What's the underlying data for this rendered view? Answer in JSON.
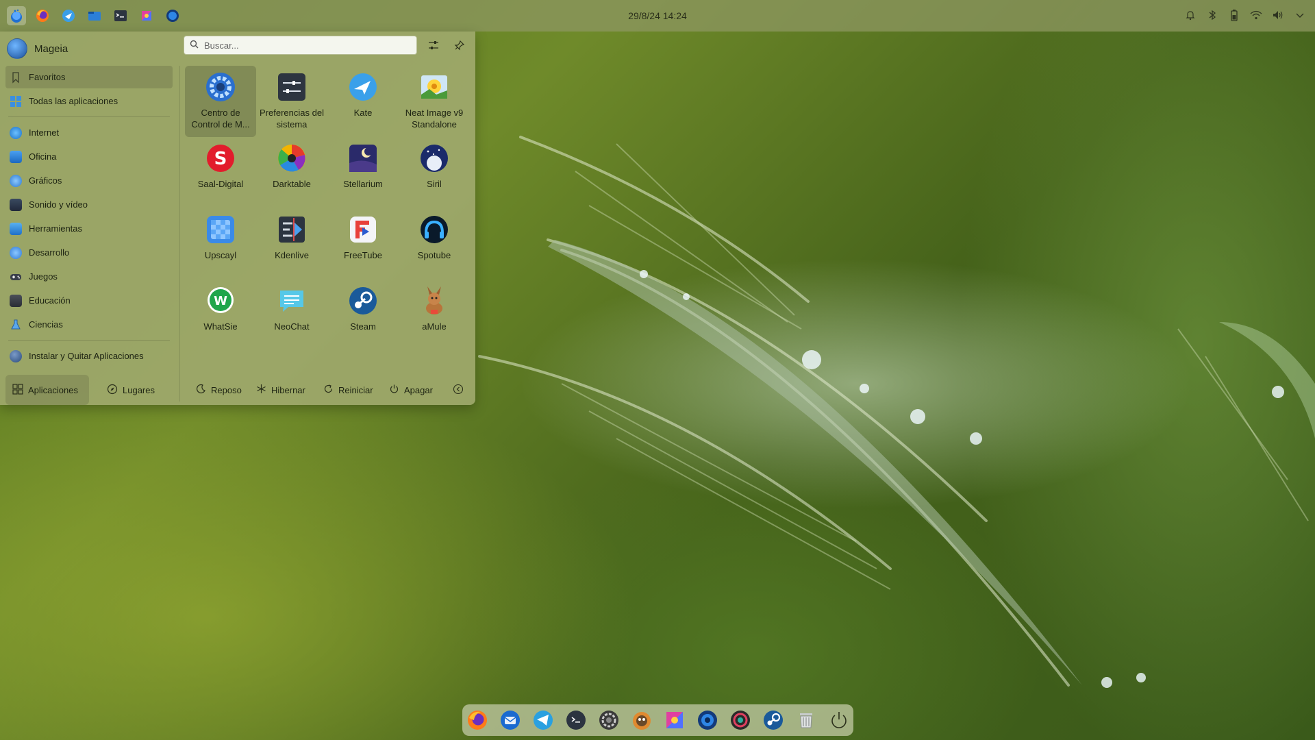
{
  "top_panel": {
    "clock": "29/8/24 14:24",
    "launchers": [
      "mageia-launcher-icon",
      "firefox-icon",
      "kate-icon",
      "dolphin-icon",
      "konsole-icon",
      "kdenlive-icon",
      "world-icon"
    ],
    "tray": [
      "bell-icon",
      "bluetooth-icon",
      "battery-icon",
      "wifi-icon",
      "volume-icon",
      "chevron-down-icon"
    ]
  },
  "launcher": {
    "user_name": "Mageia",
    "search_placeholder": "Buscar...",
    "categories": [
      {
        "label": "Favoritos",
        "icon": "bookmark-icon",
        "selected": true
      },
      {
        "label": "Todas las aplicaciones",
        "icon": "grid-icon"
      },
      {
        "label": "Internet",
        "icon": "globe-icon"
      },
      {
        "label": "Oficina",
        "icon": "office-icon"
      },
      {
        "label": "Gráficos",
        "icon": "graphics-icon"
      },
      {
        "label": "Sonido y vídeo",
        "icon": "multimedia-icon"
      },
      {
        "label": "Herramientas",
        "icon": "tools-icon"
      },
      {
        "label": "Desarrollo",
        "icon": "development-icon"
      },
      {
        "label": "Juegos",
        "icon": "gamepad-icon"
      },
      {
        "label": "Educación",
        "icon": "education-icon"
      },
      {
        "label": "Ciencias",
        "icon": "science-icon"
      },
      {
        "label": "Instalar y Quitar Aplicaciones",
        "icon": "install-icon"
      }
    ],
    "apps": [
      {
        "label": "Centro de Control de M...",
        "icon": "control-center-icon",
        "selected": true
      },
      {
        "label": "Preferencias del sistema",
        "icon": "system-settings-icon"
      },
      {
        "label": "Kate",
        "icon": "kate-icon"
      },
      {
        "label": "Neat Image v9 Standalone",
        "icon": "neat-image-icon"
      },
      {
        "label": "Saal-Digital",
        "icon": "saal-digital-icon"
      },
      {
        "label": "Darktable",
        "icon": "darktable-icon"
      },
      {
        "label": "Stellarium",
        "icon": "stellarium-icon"
      },
      {
        "label": "Siril",
        "icon": "siril-icon"
      },
      {
        "label": "Upscayl",
        "icon": "upscayl-icon"
      },
      {
        "label": "Kdenlive",
        "icon": "kdenlive-icon"
      },
      {
        "label": "FreeTube",
        "icon": "freetube-icon"
      },
      {
        "label": "Spotube",
        "icon": "spotube-icon"
      },
      {
        "label": "WhatSie",
        "icon": "whatsie-icon"
      },
      {
        "label": "NeoChat",
        "icon": "neochat-icon"
      },
      {
        "label": "Steam",
        "icon": "steam-icon"
      },
      {
        "label": "aMule",
        "icon": "amule-icon"
      }
    ],
    "footer": {
      "applications": "Aplicaciones",
      "places": "Lugares",
      "sleep": "Reposo",
      "hibernate": "Hibernar",
      "restart": "Reiniciar",
      "shutdown": "Apagar"
    }
  },
  "dock": [
    "firefox-icon",
    "thunderbird-icon",
    "telegram-icon",
    "terminal-icon",
    "aperture-icon",
    "gimp-icon",
    "kdenlive-icon",
    "world-icon",
    "obs-icon",
    "steam-icon",
    "trash-icon",
    "power-icon"
  ],
  "colors": {
    "panel": "#8c965f",
    "launcher": "#9ea86c",
    "accent": "#3a8ae0"
  }
}
